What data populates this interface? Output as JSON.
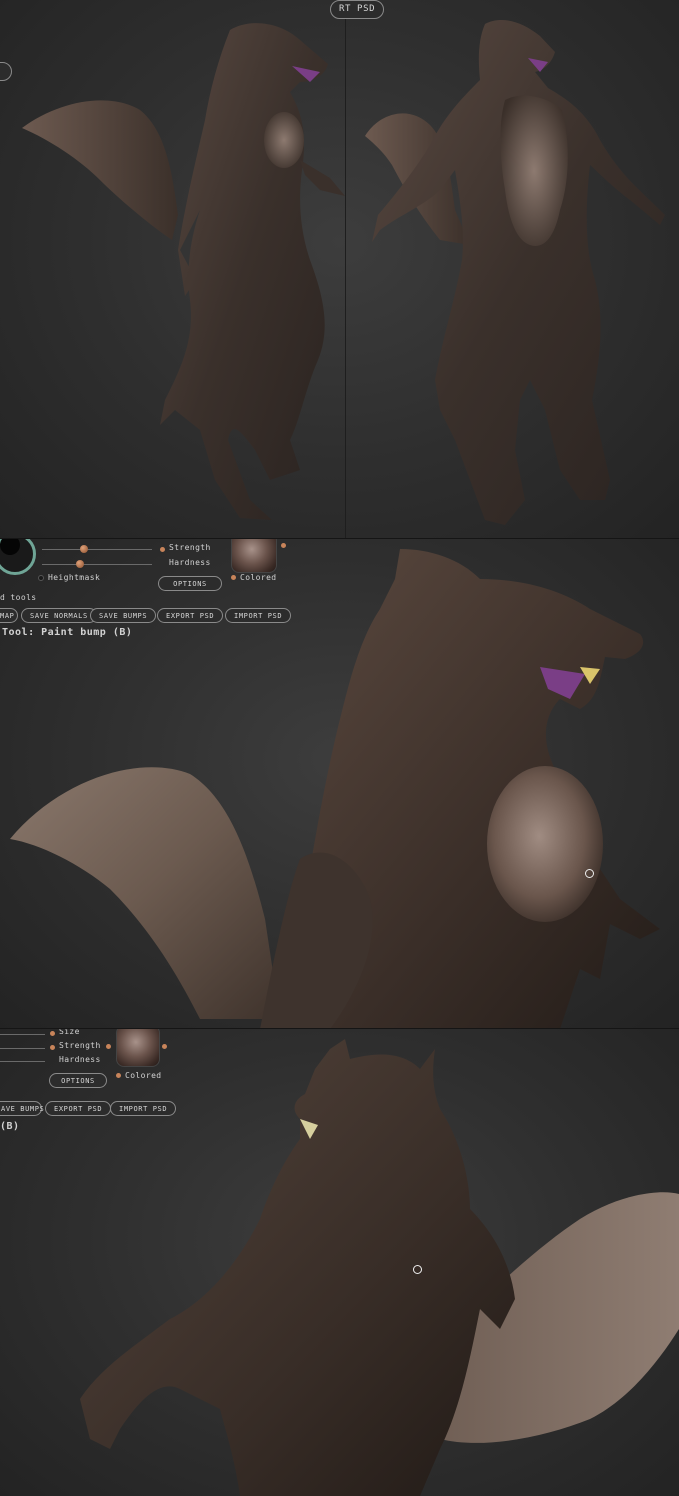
{
  "top_panel": {
    "export_psd_partial": "RT PSD"
  },
  "middle_panel": {
    "sliders": {
      "strength_label": "Strength",
      "hardness_label": "Hardness"
    },
    "heightmask_label": "Heightmask",
    "options_label": "OPTIONS",
    "colored_label": "Colored",
    "tools_label": "d tools",
    "buttons": {
      "map_partial": "MAP",
      "save_normals": "SAVE NORMALS",
      "save_bumps": "SAVE BUMPS",
      "export_psd": "EXPORT PSD",
      "import_psd": "IMPORT PSD"
    },
    "tool_title": "Tool: Paint bump (B)"
  },
  "bottom_panel": {
    "sliders": {
      "size_label": "Size",
      "strength_label": "Strength",
      "hardness_label": "Hardness"
    },
    "options_label": "OPTIONS",
    "colored_label": "Colored",
    "buttons": {
      "save_bumps_partial": "AVE BUMPS",
      "export_psd": "EXPORT PSD",
      "import_psd": "IMPORT PSD"
    },
    "tool_title_partial": "(B)"
  },
  "colors": {
    "viewport_bg": "#2f2f2f",
    "accent_dot": "#c8845a",
    "button_border": "#8a8a8a"
  }
}
